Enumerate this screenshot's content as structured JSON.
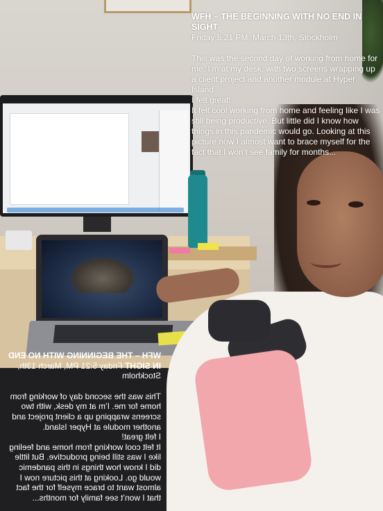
{
  "caption": {
    "title": "WFH – THE BEGINNING WITH NO END IN SIGHT",
    "dateline": "Friday 5:21 PM, March 13th, Stockholm",
    "paragraph1": "This was the second day of working from home for me. I’m at my desk, with two screens wrapping up a client project and another module at Hyper Island.",
    "paragraph2": "I felt great!",
    "paragraph3": "It felt cool working from home and feeling like I was still being productive. But little did I know how things in this pandemic would go. Looking at this picture now I almost want to brace myself for the fact that I won’t see family for months..."
  },
  "colors": {
    "caption_text": "#ffffff",
    "water_bottle": "#1f8a8e",
    "sticky_note": "#e8e04a",
    "hoodie_pink": "#f2a7ad"
  }
}
